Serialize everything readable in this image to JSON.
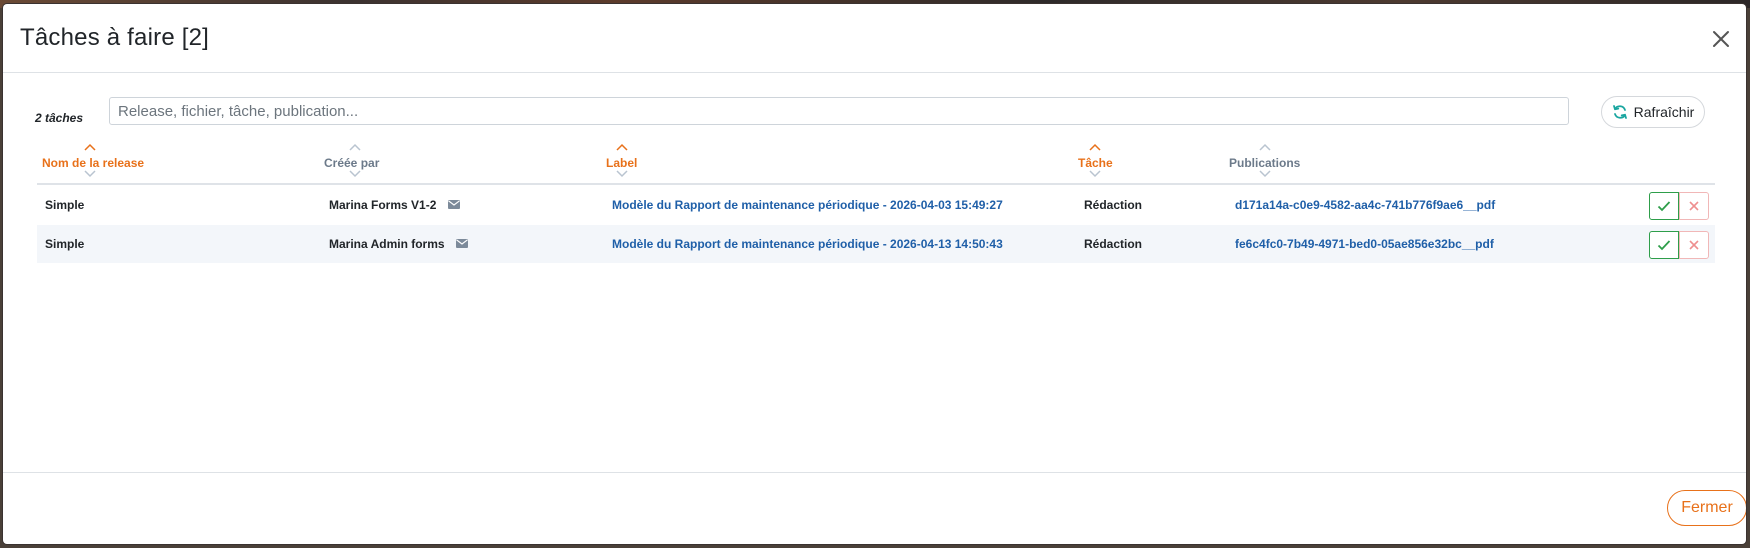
{
  "modal": {
    "title": "Tâches à faire [2]",
    "count_label": "2 tâches",
    "search_placeholder": "Release, fichier, tâche, publication...",
    "refresh_label": "Rafraîchir",
    "close_label": "Fermer"
  },
  "table": {
    "columns": [
      {
        "label": "Nom de la release",
        "sort": "asc-active"
      },
      {
        "label": "Créée par",
        "sort": "none"
      },
      {
        "label": "Label",
        "sort": "asc-active"
      },
      {
        "label": "Tâche",
        "sort": "asc-active"
      },
      {
        "label": "Publications",
        "sort": "none"
      }
    ],
    "rows": [
      {
        "release": "Simple",
        "created_by": "Marina Forms V1-2",
        "label": "Modèle du Rapport de maintenance périodique - 2026-04-03 15:49:27",
        "task": "Rédaction",
        "publication": "d171a14a-c0e9-4582-aa4c-741b776f9ae6__pdf"
      },
      {
        "release": "Simple",
        "created_by": "Marina Admin forms",
        "label": "Modèle du Rapport de maintenance périodique - 2026-04-13 14:50:43",
        "task": "Rédaction",
        "publication": "fe6c4fc0-7b49-4971-bed0-05ae856e32bc__pdf"
      }
    ]
  },
  "icons": {
    "close": "close-icon",
    "refresh": "refresh-icon",
    "mail": "envelope-icon",
    "approve": "check-icon",
    "reject": "x-icon"
  },
  "colors": {
    "accent": "#e8711a",
    "link": "#1f5fa8",
    "approve": "#2e9e4a",
    "reject": "#f1b7b7",
    "refresh": "#1aa6a0"
  }
}
